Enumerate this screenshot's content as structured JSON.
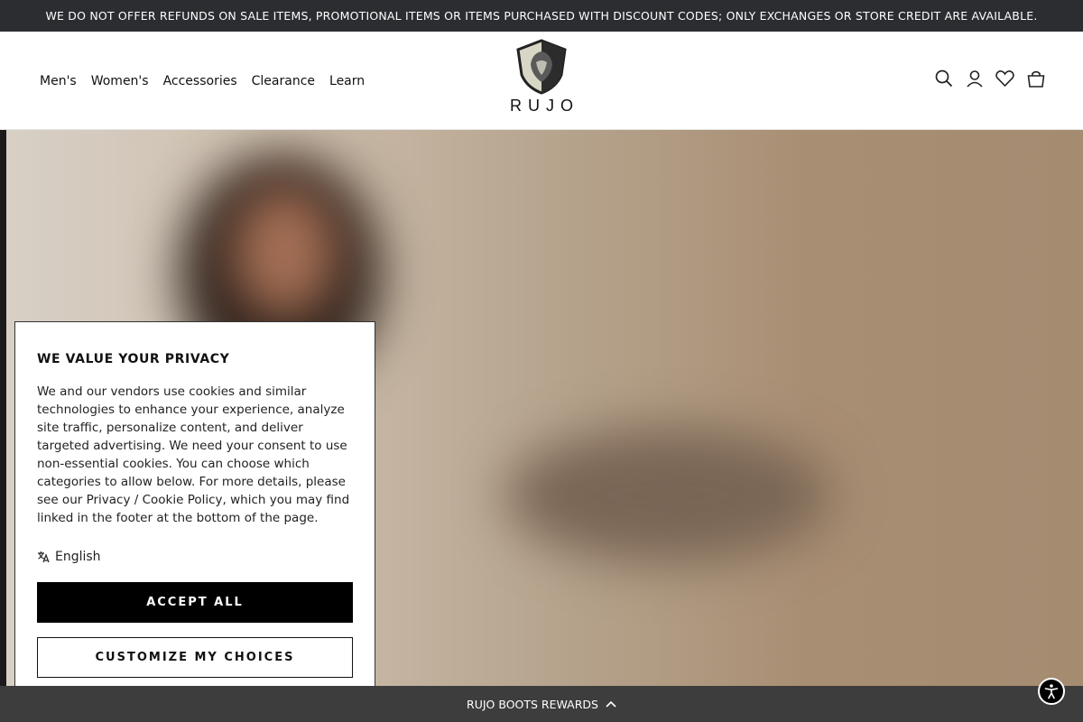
{
  "announcement": {
    "text": "WE DO NOT OFFER REFUNDS ON SALE ITEMS, PROMOTIONAL ITEMS OR ITEMS PURCHASED WITH DISCOUNT CODES; ONLY EXCHANGES OR STORE CREDIT ARE AVAILABLE."
  },
  "header": {
    "nav": [
      "Men's",
      "Women's",
      "Accessories",
      "Clearance",
      "Learn"
    ],
    "logo_text": "RUJO",
    "icons": [
      "search-icon",
      "account-icon",
      "wishlist-icon",
      "cart-icon"
    ]
  },
  "cookie_banner": {
    "title": "WE VALUE YOUR PRIVACY",
    "body": "We and our vendors use cookies and similar technologies to enhance your experience, analyze site traffic, personalize content, and deliver targeted advertising. We need your consent to use non-essential cookies. You can choose which categories to allow below. For more details, please see our Privacy / Cookie Policy, which you may find linked in the footer at the bottom of the page.",
    "language": "English",
    "accept_label": "ACCEPT ALL",
    "customize_label": "CUSTOMIZE MY CHOICES"
  },
  "rewards_bar": {
    "label": "RUJO BOOTS REWARDS",
    "icon": "chevron-up-icon"
  },
  "accessibility": {
    "icon": "accessibility-icon"
  },
  "colors": {
    "announce_bg": "#2b2d31",
    "rewards_bg": "#3d3d3d",
    "accent": "#000000"
  }
}
